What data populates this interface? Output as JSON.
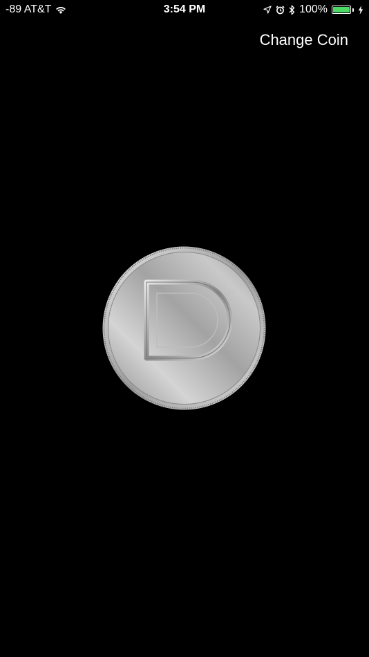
{
  "status_bar": {
    "carrier": "-89 AT&T",
    "time": "3:54 PM",
    "battery_percent": "100%",
    "battery_level": 1.0,
    "battery_color": "#4cd964",
    "icons": [
      "wifi-icon",
      "location-arrow-icon",
      "alarm-icon",
      "bluetooth-icon",
      "battery-icon",
      "charging-bolt-icon"
    ]
  },
  "nav": {
    "change_coin_label": "Change Coin"
  },
  "coin": {
    "letter": "D",
    "color": "#b9b9b9"
  }
}
